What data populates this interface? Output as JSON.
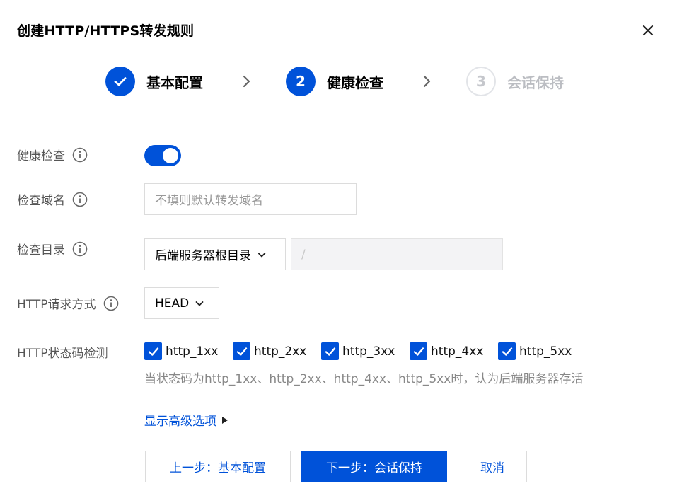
{
  "dialog": {
    "title": "创建HTTP/HTTPS转发规则",
    "close_icon": "close-icon"
  },
  "steps": [
    {
      "number": "1",
      "label": "基本配置",
      "state": "done",
      "icon": "check-icon"
    },
    {
      "number": "2",
      "label": "健康检查",
      "state": "active"
    },
    {
      "number": "3",
      "label": "会话保持",
      "state": "pending"
    }
  ],
  "form": {
    "health_check": {
      "label": "健康检查",
      "enabled": true
    },
    "check_domain": {
      "label": "检查域名",
      "placeholder": "不填则默认转发域名",
      "value": ""
    },
    "check_path": {
      "label": "检查目录",
      "select_value": "后端服务器根目录",
      "path_placeholder": "/"
    },
    "http_method": {
      "label": "HTTP请求方式",
      "value": "HEAD"
    },
    "status_codes": {
      "label": "HTTP状态码检测",
      "options": [
        {
          "label": "http_1xx",
          "checked": true
        },
        {
          "label": "http_2xx",
          "checked": true
        },
        {
          "label": "http_3xx",
          "checked": true
        },
        {
          "label": "http_4xx",
          "checked": true
        },
        {
          "label": "http_5xx",
          "checked": true
        }
      ],
      "hint": "当状态码为http_1xx、http_2xx、http_4xx、http_5xx时，认为后端服务器存活"
    },
    "advanced_link": "显示高级选项"
  },
  "buttons": {
    "prev": "上一步：基本配置",
    "next": "下一步：会话保持",
    "cancel": "取消"
  },
  "colors": {
    "primary": "#0052d9",
    "disabled_bg": "#f3f3f5"
  }
}
